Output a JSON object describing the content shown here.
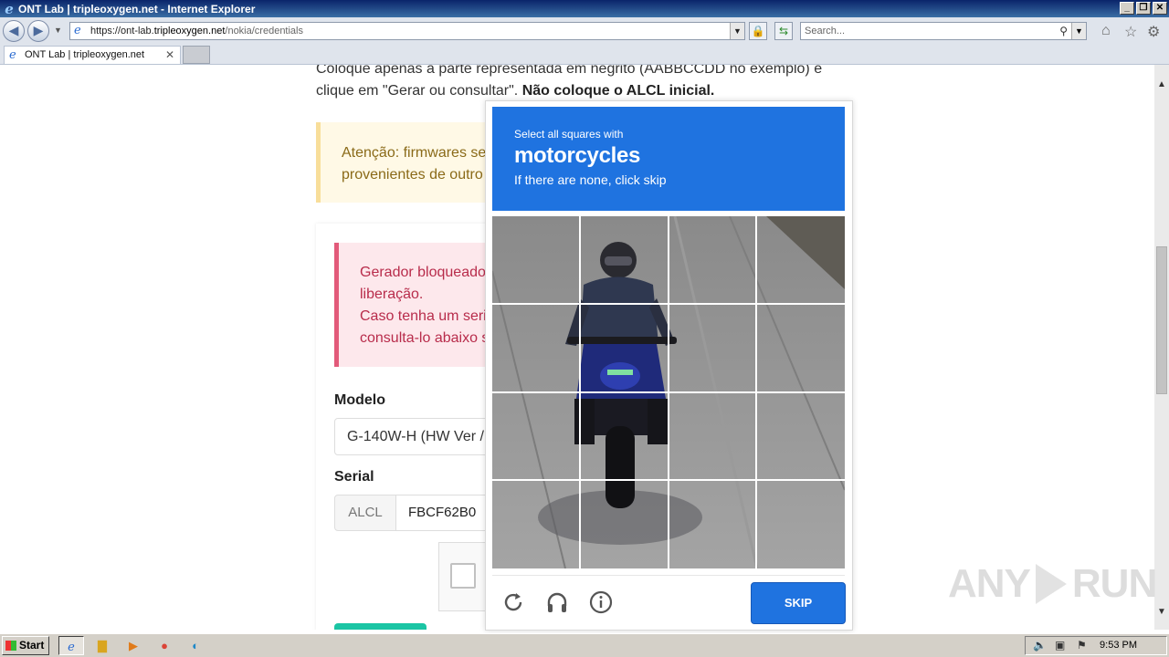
{
  "window": {
    "title": "ONT Lab | tripleoxygen.net - Internet Explorer",
    "controls": [
      "_",
      "❐",
      "✕"
    ]
  },
  "nav": {
    "url_prefix": "https://ont-lab.",
    "url_domain": "tripleoxygen.net",
    "url_path": "/nokia/credentials",
    "search_placeholder": "Search..."
  },
  "tabs": [
    {
      "label": "ONT Lab | tripleoxygen.net",
      "active": true
    }
  ],
  "page": {
    "intro_line1": "Coloque apenas a parte representada em negrito (AABBCCDD no exemplo) e",
    "intro_line2_a": "clique em \"Gerar ou consultar\". ",
    "intro_line2_b": "Não coloque o ALCL inicial.",
    "warning_line1": "Atenção: firmwares ser",
    "warning_line2": "provenientes de outro",
    "error_line1": "Gerador bloqueado",
    "error_line2": "liberação.",
    "error_line3": "Caso tenha um seria",
    "error_line4": "consulta-lo abaixo s",
    "model_label": "Modelo",
    "model_value": "G-140W-H (HW Ver /",
    "serial_label": "Serial",
    "serial_prefix": "ALCL",
    "serial_value": "FBCF62B0"
  },
  "captcha": {
    "prompt_small": "Select all squares with",
    "prompt_big": "motorcycles",
    "prompt_sub": "If there are none, click skip",
    "grid_rows": 4,
    "grid_cols": 4,
    "skip_label": "SKIP",
    "footer_icons": [
      "refresh-icon",
      "headphones-icon",
      "info-icon"
    ]
  },
  "watermark": {
    "text_left": "ANY",
    "text_right": "RUN"
  },
  "taskbar": {
    "start_label": "Start",
    "clock": "9:53 PM"
  },
  "colors": {
    "captcha_blue": "#1f73e0",
    "warning_bg": "#fff9e6",
    "error_bg": "#fde8ec",
    "error_text": "#b82c4b",
    "accent_green": "#1bc5a4"
  }
}
